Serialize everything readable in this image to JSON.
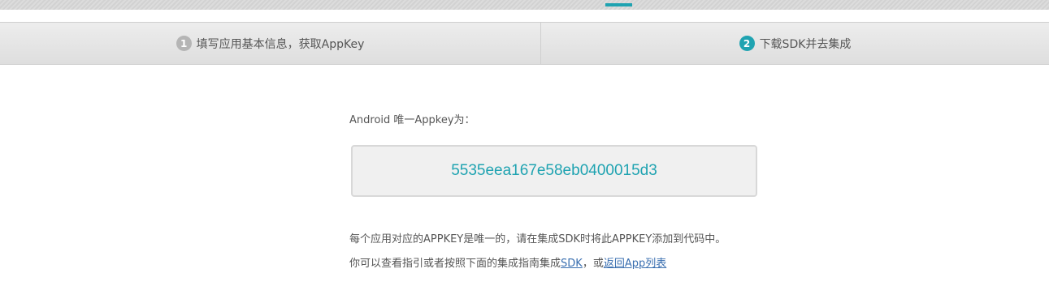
{
  "steps": [
    {
      "num": "1",
      "label": "填写应用基本信息，获取AppKey"
    },
    {
      "num": "2",
      "label": "下载SDK并去集成"
    }
  ],
  "main": {
    "appkey_label": "Android 唯一Appkey为：",
    "appkey_value": "5535eea167e58eb0400015d3",
    "note_line1": "每个应用对应的APPKEY是唯一的，请在集成SDK时将此APPKEY添加到代码中。",
    "note_line2_prefix": "你可以查看指引或者按照下面的集成指南集成",
    "sdk_link": "SDK",
    "note_line2_mid": "，或",
    "back_link": "返回App列表"
  },
  "colors": {
    "accent": "#1fa3b1",
    "link": "#3a6fb0",
    "inactive_step": "#b5b5b5"
  }
}
